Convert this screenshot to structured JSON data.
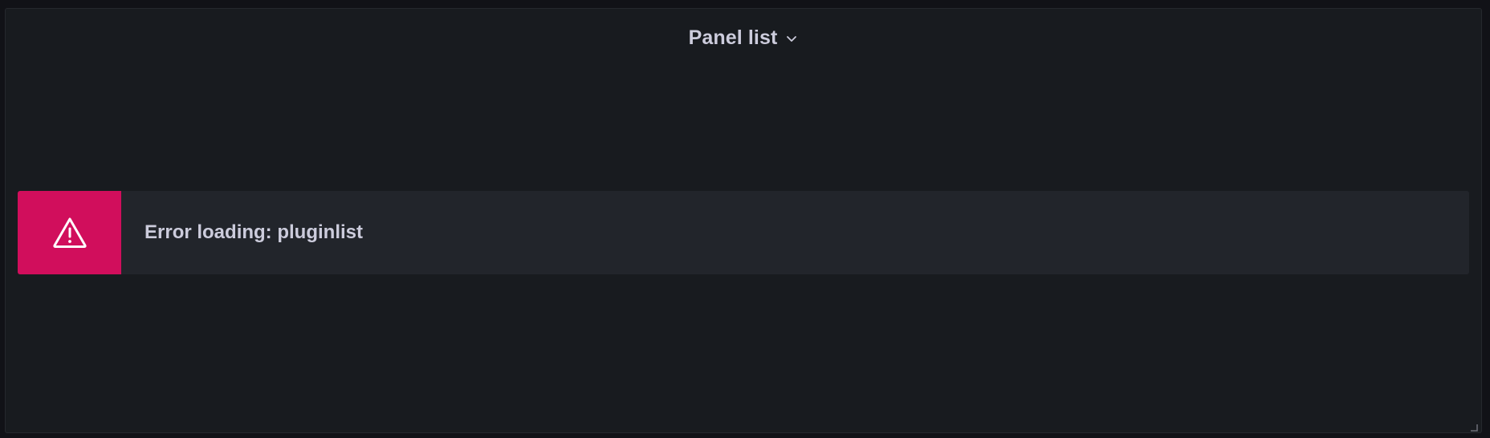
{
  "panel": {
    "title": "Panel list",
    "title_icon": "chevron-down-icon",
    "resize_icon": "resize-handle-icon"
  },
  "alert": {
    "message": "Error loading: pluginlist",
    "icon": "exclamation-triangle-icon",
    "severity_color": "#d10e5c"
  },
  "colors": {
    "page_background": "#111217",
    "panel_background": "#181b1f",
    "alert_background": "#22252b",
    "text": "#ccccdc"
  }
}
